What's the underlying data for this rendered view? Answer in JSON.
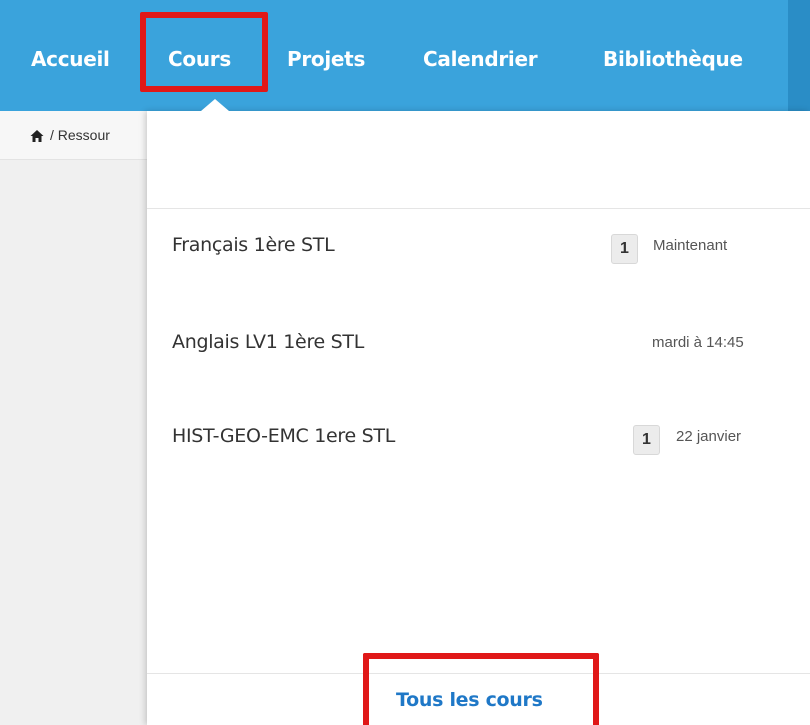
{
  "nav": {
    "items": [
      {
        "label": "Accueil"
      },
      {
        "label": "Cours"
      },
      {
        "label": "Projets"
      },
      {
        "label": "Calendrier"
      },
      {
        "label": "Bibliothèque"
      }
    ],
    "active": "Cours"
  },
  "breadcrumb": {
    "icon": "home-icon",
    "text": "/ Ressour"
  },
  "courses_dropdown": {
    "items": [
      {
        "name": "Français 1ère STL",
        "badge": "1",
        "time": "Maintenant"
      },
      {
        "name": "Anglais LV1 1ère STL",
        "badge": "",
        "time": "mardi à 14:45"
      },
      {
        "name": "HIST-GEO-EMC 1ere STL",
        "badge": "1",
        "time": "22 janvier"
      }
    ],
    "footer_link": "Tous les cours"
  },
  "colors": {
    "navbar": "#3aa3dc",
    "highlight": "#e01818",
    "link": "#1f78c7"
  }
}
